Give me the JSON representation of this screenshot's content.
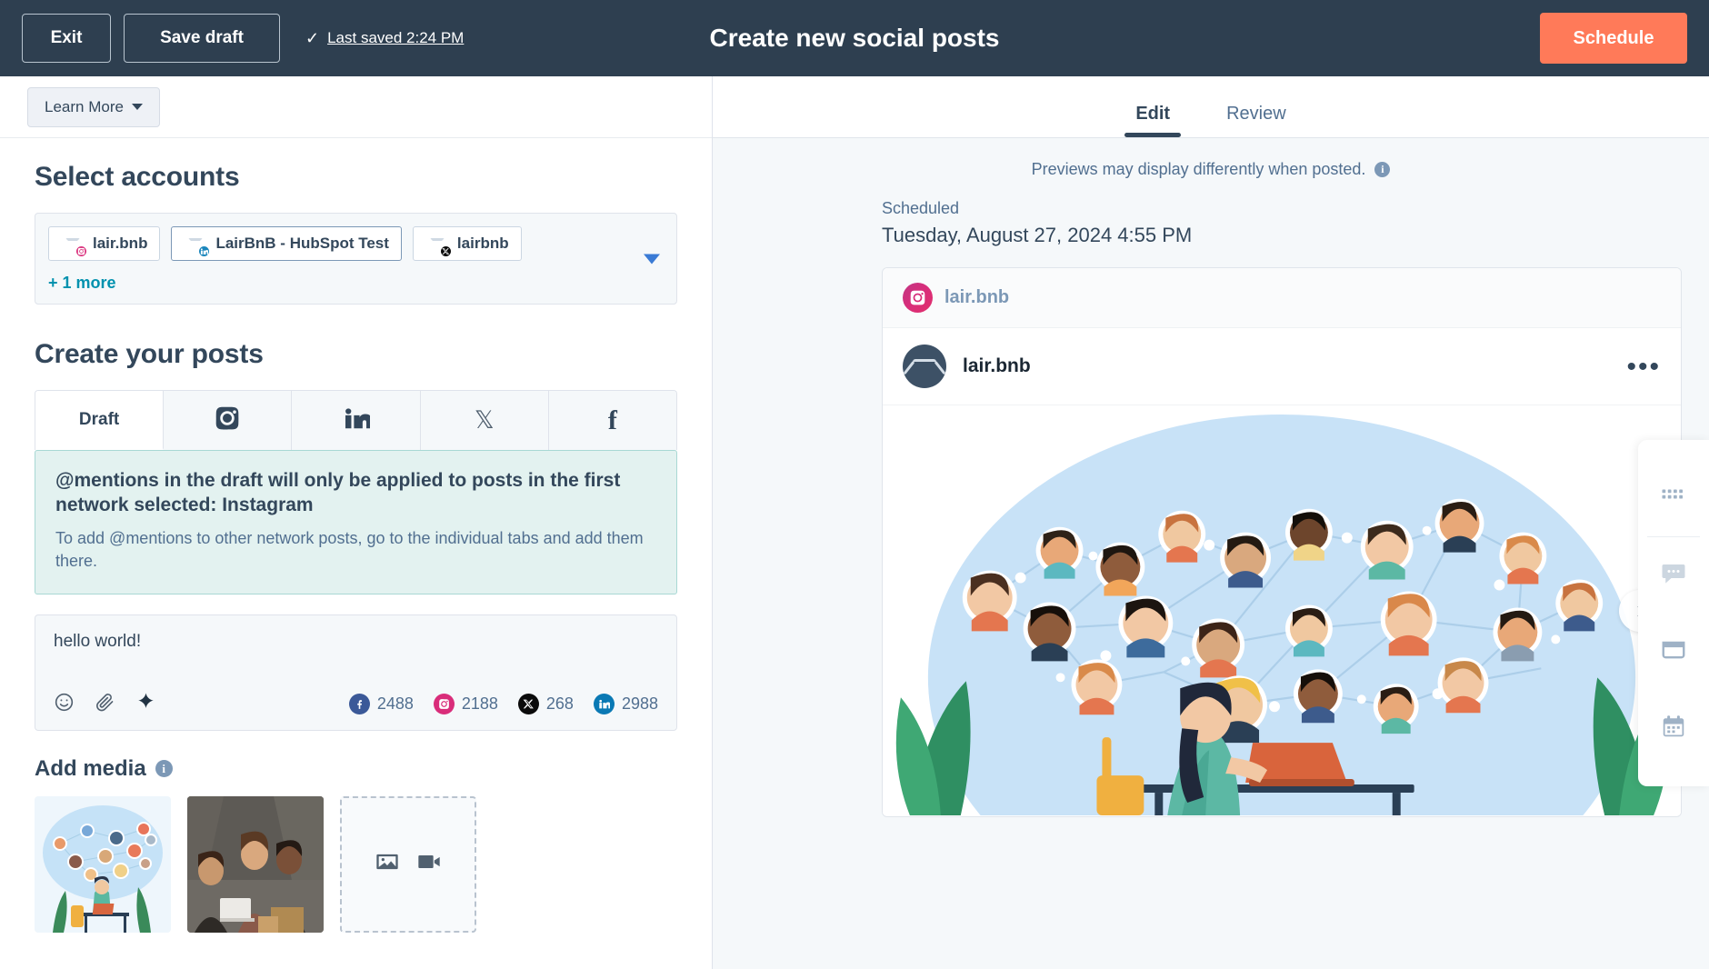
{
  "topbar": {
    "exit_label": "Exit",
    "save_draft_label": "Save draft",
    "last_saved_label": "Last saved 2:24 PM",
    "title": "Create new social posts",
    "schedule_label": "Schedule",
    "accent_orange": "#ff7a59",
    "bg": "#2e3f50"
  },
  "left": {
    "learn_more_label": "Learn More",
    "accounts_heading": "Select accounts",
    "accounts": [
      {
        "name": "lair.bnb",
        "network": "instagram"
      },
      {
        "name": "LairBnB - HubSpot Test",
        "network": "linkedin"
      },
      {
        "name": "lairbnb",
        "network": "x"
      }
    ],
    "more_accounts_label": "+ 1 more",
    "posts_heading": "Create your posts",
    "tabs": [
      {
        "label": "Draft",
        "icon": "text",
        "active": true
      },
      {
        "label": "",
        "icon": "instagram-icon",
        "active": false
      },
      {
        "label": "",
        "icon": "linkedin-icon",
        "active": false
      },
      {
        "label": "",
        "icon": "x-icon",
        "active": false
      },
      {
        "label": "",
        "icon": "facebook-icon",
        "active": false
      }
    ],
    "alert": {
      "title": "@mentions in the draft will only be applied to posts in the first network selected: Instagram",
      "body": "To add @mentions to other network posts, go to the individual tabs and add them there.",
      "bg": "#e3f2f0"
    },
    "composer": {
      "text": "hello world!",
      "icons": [
        "emoji-icon",
        "attachment-icon",
        "ai-sparkle-icon"
      ],
      "counts": [
        {
          "network": "facebook",
          "value": "2488",
          "color": "#3b5998"
        },
        {
          "network": "instagram",
          "value": "2188",
          "color": "#d92d7a"
        },
        {
          "network": "x",
          "value": "268",
          "color": "#0b0b0b"
        },
        {
          "network": "linkedin",
          "value": "2988",
          "color": "#0a79b4"
        }
      ]
    },
    "media": {
      "heading": "Add media",
      "thumbnails": [
        "network-illustration",
        "team-photo"
      ],
      "upload_icons": [
        "image-icon",
        "video-icon"
      ]
    }
  },
  "right": {
    "tabs": [
      {
        "label": "Edit",
        "active": true
      },
      {
        "label": "Review",
        "active": false
      }
    ],
    "preview_note": "Previews may display differently when posted.",
    "scheduled_label": "Scheduled",
    "scheduled_datetime": "Tuesday, August 27, 2024 4:55 PM",
    "card": {
      "network_name": "lair.bnb",
      "network": "instagram",
      "user_name": "lair.bnb",
      "menu_glyph": "•••"
    },
    "rail_items": [
      "grid-apps-icon",
      "chat-bubble-icon",
      "notes-card-icon",
      "calendar-icon"
    ]
  }
}
